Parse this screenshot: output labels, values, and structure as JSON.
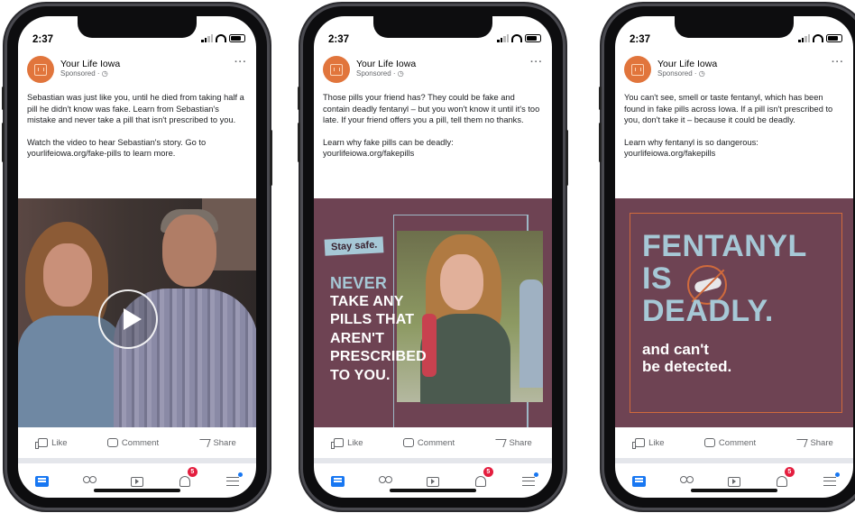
{
  "colors": {
    "fb_blue": "#1877f2",
    "ad_plum": "#6e4353",
    "ad_light_blue": "#a6c8d6",
    "ad_orange": "#d06a3c",
    "brand_orange": "#e1753c"
  },
  "phones": [
    {
      "status_time": "2:37",
      "page_name": "Your Life Iowa",
      "sponsored": "Sponsored · ◷",
      "paragraphs": [
        "Sebastian was just like you, until he died from taking half a pill he didn't know was fake. Learn from Sebastian's mistake and never take a pill that isn't prescribed to you.",
        "Watch the video to hear Sebastian's story. Go to yourlifeiowa.org/fake-pills to learn more."
      ],
      "media_icon": "play-icon",
      "actions": {
        "like": "Like",
        "comment": "Comment",
        "share": "Share"
      },
      "notification_badge": "5"
    },
    {
      "status_time": "2:37",
      "page_name": "Your Life Iowa",
      "sponsored": "Sponsored · ◷",
      "paragraphs": [
        "Those pills your friend has? They could be fake and contain deadly fentanyl – but you won't know it until it's too late. If your friend offers you a pill, tell them no thanks.",
        "Learn why fake pills can be deadly: yourlifeiowa.org/fakepills"
      ],
      "ad": {
        "tag": "Stay safe.",
        "headline_lines": [
          "NEVER",
          "TAKE ANY",
          "PILLS THAT",
          "AREN'T",
          "PRESCRIBED",
          "TO YOU."
        ]
      },
      "actions": {
        "like": "Like",
        "comment": "Comment",
        "share": "Share"
      },
      "notification_badge": "5"
    },
    {
      "status_time": "2:37",
      "page_name": "Your Life Iowa",
      "sponsored": "Sponsored · ◷",
      "paragraphs": [
        "You can't see, smell or taste fentanyl, which has been found in fake pills across Iowa. If a pill isn't prescribed to you, don't take it – because it could be deadly.",
        "Learn why fentanyl is so dangerous: yourlifeiowa.org/fakepills"
      ],
      "ad": {
        "line1": "FENTANYL",
        "line2": "IS",
        "line3": "DEADLY.",
        "sub_lines": [
          "and can't",
          "be detected."
        ]
      },
      "actions": {
        "like": "Like",
        "comment": "Comment",
        "share": "Share"
      },
      "notification_badge": "5"
    }
  ]
}
